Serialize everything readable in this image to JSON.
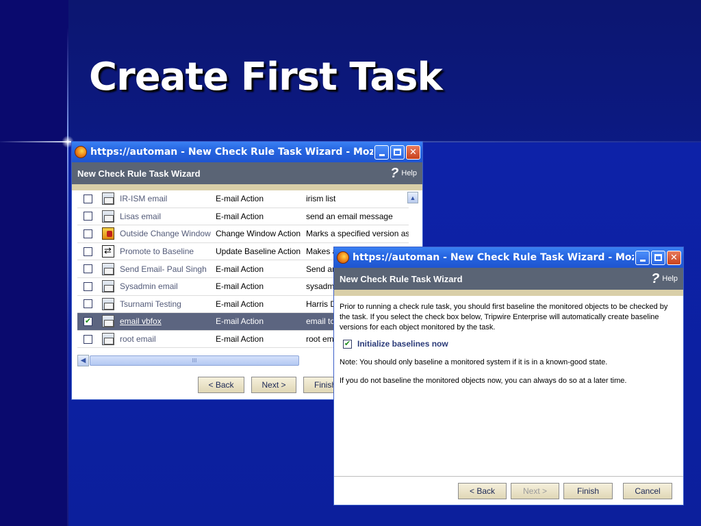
{
  "slide": {
    "title": "Create First Task"
  },
  "window1": {
    "title": "https://automan - New Check Rule Task Wizard - Mozilla Fi...",
    "header": "New Check Rule Task Wizard",
    "help_label": "Help",
    "rows": [
      {
        "name": "IR-ISM email",
        "type": "E-mail Action",
        "desc": "irism list",
        "icon": "mail-icon",
        "checked": false,
        "selected": false
      },
      {
        "name": "Lisas email",
        "type": "E-mail Action",
        "desc": "send an email message",
        "icon": "mail-icon",
        "checked": false,
        "selected": false
      },
      {
        "name": "Outside Change Window",
        "type": "Change Window Action",
        "desc": "Marks a specified version as",
        "icon": "change-window-icon",
        "checked": false,
        "selected": false
      },
      {
        "name": "Promote to Baseline",
        "type": "Update Baseline Action",
        "desc": "Makes a",
        "icon": "baseline-icon",
        "checked": false,
        "selected": false
      },
      {
        "name": "Send Email- Paul Singh",
        "type": "E-mail Action",
        "desc": "Send an",
        "icon": "mail-icon",
        "checked": false,
        "selected": false
      },
      {
        "name": "Sysadmin email",
        "type": "E-mail Action",
        "desc": "sysadm",
        "icon": "mail-icon",
        "checked": false,
        "selected": false
      },
      {
        "name": "Tsurnami Testing",
        "type": "E-mail Action",
        "desc": "Harris D",
        "icon": "mail-icon",
        "checked": false,
        "selected": false
      },
      {
        "name": "email vbfox",
        "type": "E-mail Action",
        "desc": "email to",
        "icon": "mail-icon",
        "checked": true,
        "selected": true
      },
      {
        "name": "root email",
        "type": "E-mail Action",
        "desc": "root ema",
        "icon": "mail-icon",
        "checked": false,
        "selected": false
      }
    ],
    "scroll_thumb_label": "III",
    "buttons": {
      "back": "< Back",
      "next": "Next >",
      "finish": "Finish"
    }
  },
  "window2": {
    "title": "https://automan - New Check Rule Task Wizard - Mozilla Fi...",
    "header": "New Check Rule Task Wizard",
    "help_label": "Help",
    "intro": "Prior to running a check rule task, you should first baseline the monitored objects to be checked by the task. If you select the check box below, Tripwire Enterprise will automatically create baseline versions for each object monitored by the task.",
    "initialize_label": "Initialize baselines now",
    "initialize_checked": true,
    "note": "Note: You should only baseline a monitored system if it is in a known-good state.",
    "later": "If you do not baseline the monitored objects now, you can always do so at a later time.",
    "buttons": {
      "back": "< Back",
      "next": "Next >",
      "finish": "Finish",
      "cancel": "Cancel"
    }
  },
  "colors": {
    "slide_background": "#0c1a85",
    "titlebar": "#2564e0",
    "wizard_header": "#5a6475",
    "selected_row": "#5c6580",
    "button_face": "#ece5c8"
  }
}
